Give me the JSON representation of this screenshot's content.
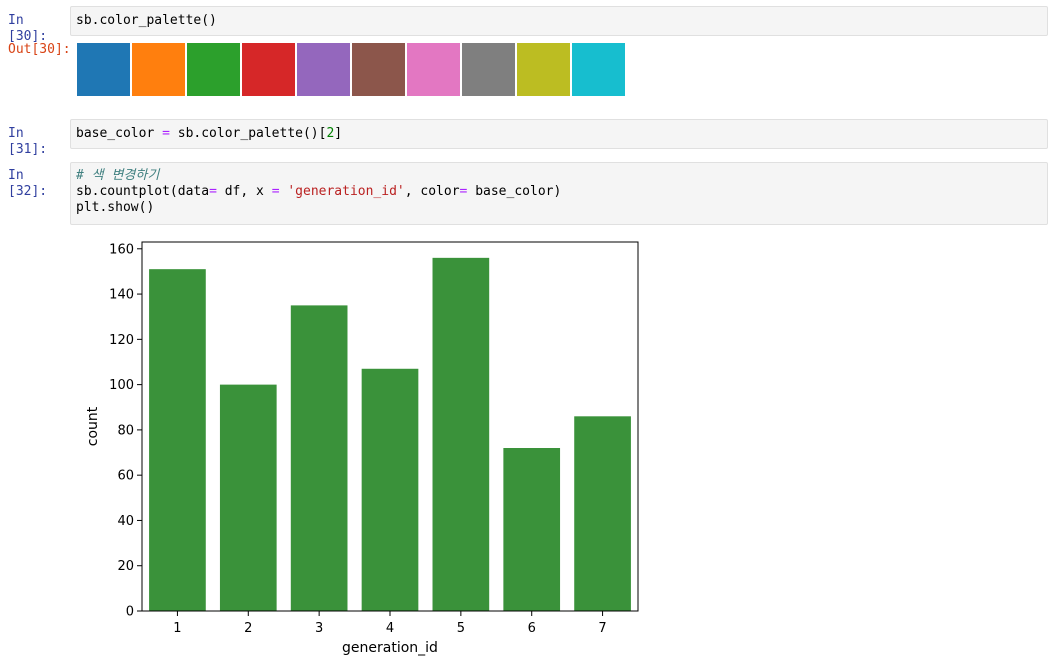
{
  "cells": [
    {
      "prompt": "In [30]:",
      "code_lines": [
        [
          {
            "t": "sb.color_palette()",
            "c": "plain"
          }
        ]
      ]
    },
    {
      "out_prompt": "Out[30]:",
      "palette": [
        "#1f77b4",
        "#ff7f0e",
        "#2ca02c",
        "#d62728",
        "#9467bd",
        "#8c564b",
        "#e377c2",
        "#7f7f7f",
        "#bcbd22",
        "#17becf"
      ]
    },
    {
      "prompt": "In [31]:",
      "code_lines": [
        [
          {
            "t": "base_color ",
            "c": "plain"
          },
          {
            "t": "=",
            "c": "op"
          },
          {
            "t": " sb.color_palette()[",
            "c": "plain"
          },
          {
            "t": "2",
            "c": "num"
          },
          {
            "t": "]",
            "c": "plain"
          }
        ]
      ]
    },
    {
      "prompt": "In [32]:",
      "code_lines": [
        [
          {
            "t": "# 색 변경하기",
            "c": "comment"
          }
        ],
        [
          {
            "t": "sb.countplot(data",
            "c": "plain"
          },
          {
            "t": "=",
            "c": "op"
          },
          {
            "t": " df, x ",
            "c": "plain"
          },
          {
            "t": "=",
            "c": "op"
          },
          {
            "t": " ",
            "c": "plain"
          },
          {
            "t": "'generation_id'",
            "c": "str"
          },
          {
            "t": ", color",
            "c": "plain"
          },
          {
            "t": "=",
            "c": "op"
          },
          {
            "t": " base_color)",
            "c": "plain"
          }
        ],
        [
          {
            "t": "plt.show()",
            "c": "plain"
          }
        ]
      ]
    }
  ],
  "chart_data": {
    "type": "bar",
    "categories": [
      "1",
      "2",
      "3",
      "4",
      "5",
      "6",
      "7"
    ],
    "values": [
      151,
      100,
      135,
      107,
      156,
      72,
      86
    ],
    "xlabel": "generation_id",
    "ylabel": "count",
    "ylim": [
      0,
      163
    ],
    "yticks": [
      0,
      20,
      40,
      60,
      80,
      100,
      120,
      140,
      160
    ],
    "bar_color": "#3a923a",
    "grid": false
  }
}
